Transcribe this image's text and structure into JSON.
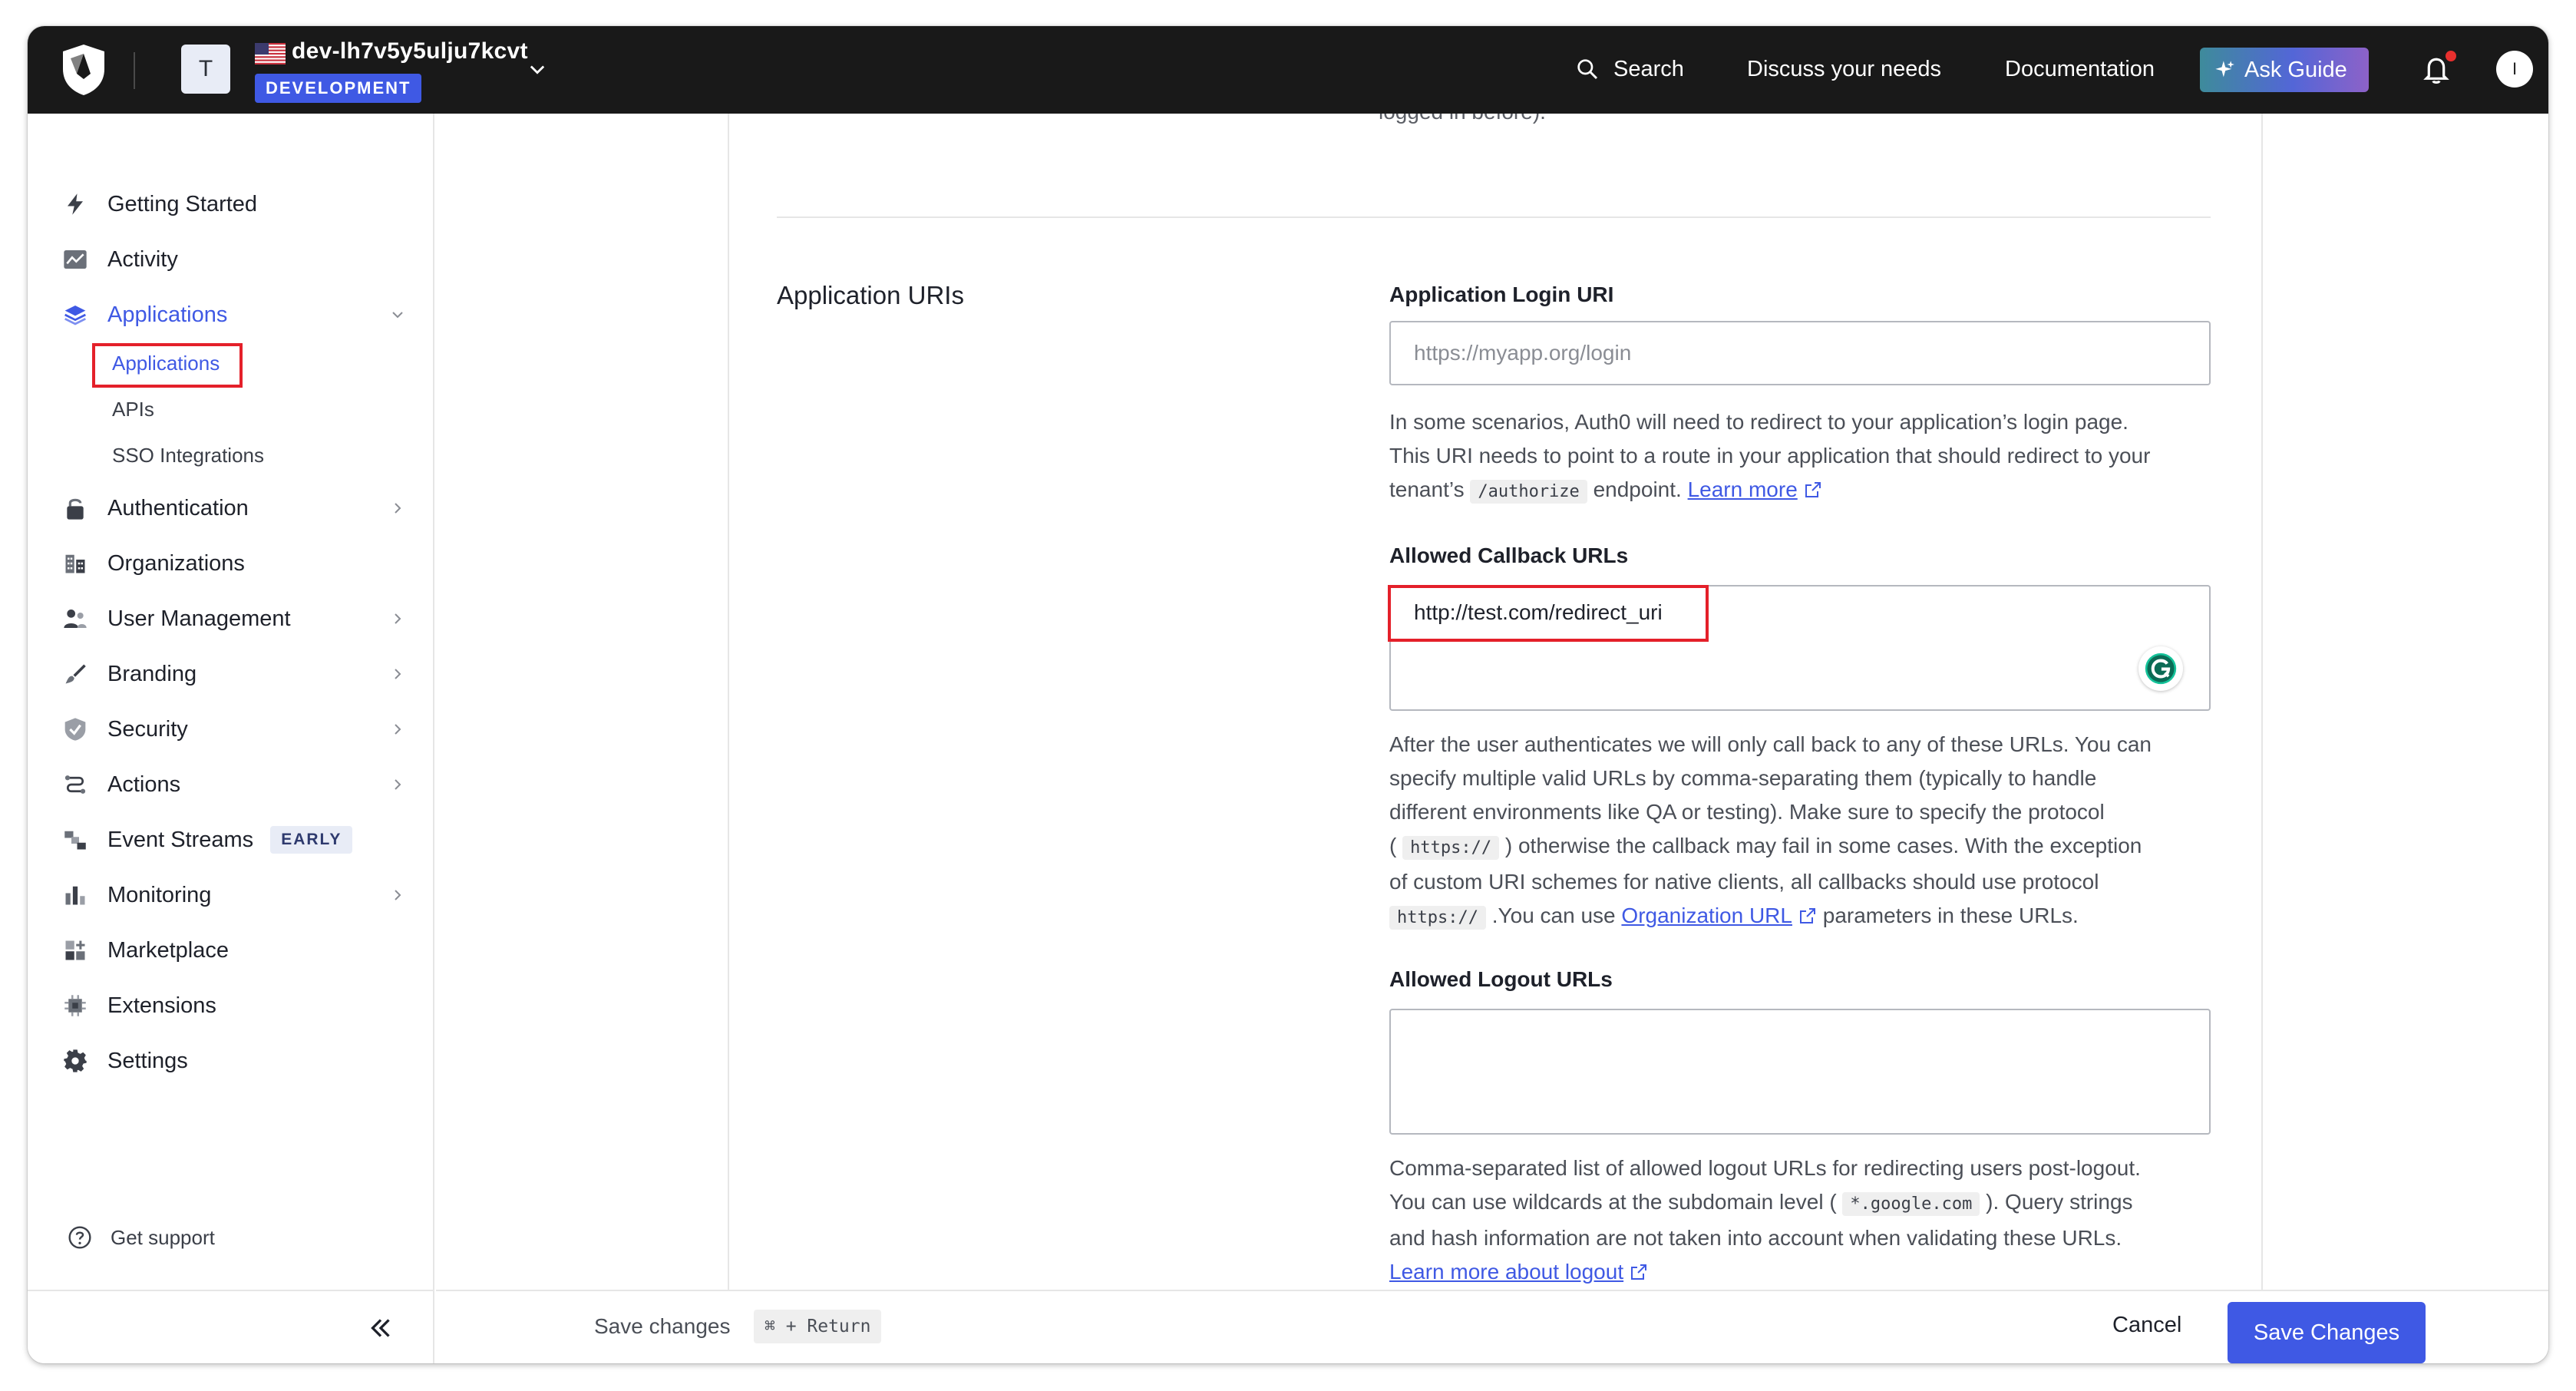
{
  "topbar": {
    "tenant_initial": "T",
    "tenant_name": "dev-lh7v5y5ulju7kcvt",
    "env_badge": "DEVELOPMENT",
    "search_label": "Search",
    "discuss_label": "Discuss your needs",
    "docs_label": "Documentation",
    "ask_guide_label": "Ask Guide",
    "user_initial": "I",
    "notification_dot_color": "#e8302e"
  },
  "sidebar": {
    "items": [
      {
        "label": "Getting Started",
        "icon": "lightning-icon"
      },
      {
        "label": "Activity",
        "icon": "activity-chart-icon"
      },
      {
        "label": "Applications",
        "icon": "layers-icon"
      },
      {
        "label": "Authentication",
        "icon": "lock-icon"
      },
      {
        "label": "Organizations",
        "icon": "building-icon"
      },
      {
        "label": "User Management",
        "icon": "users-icon"
      },
      {
        "label": "Branding",
        "icon": "brush-icon"
      },
      {
        "label": "Security",
        "icon": "shield-check-icon"
      },
      {
        "label": "Actions",
        "icon": "flow-icon"
      },
      {
        "label": "Event Streams",
        "icon": "streams-icon",
        "badge": "EARLY"
      },
      {
        "label": "Monitoring",
        "icon": "bar-chart-icon"
      },
      {
        "label": "Marketplace",
        "icon": "grid-plus-icon"
      },
      {
        "label": "Extensions",
        "icon": "chip-icon"
      },
      {
        "label": "Settings",
        "icon": "gear-icon"
      }
    ],
    "sub_items": [
      "Applications",
      "APIs",
      "SSO Integrations"
    ],
    "get_support": "Get support"
  },
  "main": {
    "cut_text": "logged in before).",
    "section_title": "Application URIs",
    "login_uri": {
      "label": "Application Login URI",
      "value": "",
      "placeholder": "https://myapp.org/login",
      "help_1": "In some scenarios, Auth0 will need to redirect to your application’s login page.",
      "help_2": "This URI needs to point to a route in your application that should redirect to your",
      "help_3a": "tenant’s",
      "help_3code": "/authorize",
      "help_3b": "endpoint.",
      "help_link": "Learn more"
    },
    "callback": {
      "label": "Allowed Callback URLs",
      "value": "http://test.com/redirect_uri",
      "help_1": "After the user authenticates we will only call back to any of these URLs. You can",
      "help_2": "specify multiple valid URLs by comma-separating them (typically to handle",
      "help_3": "different environments like QA or testing). Make sure to specify the protocol",
      "help_4a": "(",
      "help_4code": "https://",
      "help_4b": ") otherwise the callback may fail in some cases. With the exception",
      "help_5": "of custom URI schemes for native clients, all callbacks should use protocol",
      "help_6code": "https://",
      "help_6a": ".You can use",
      "help_6link": "Organization URL",
      "help_6b": "parameters in these URLs."
    },
    "logout": {
      "label": "Allowed Logout URLs",
      "value": "",
      "help_1": "Comma-separated list of allowed logout URLs for redirecting users post-logout.",
      "help_2a": "You can use wildcards at the subdomain level (",
      "help_2code": "*.google.com",
      "help_2b": "). Query strings",
      "help_3": "and hash information are not taken into account when validating these URLs.",
      "help_link": "Learn more about logout"
    }
  },
  "footer": {
    "save_hint": "Save changes",
    "shortcut": "⌘ + Return",
    "cancel_label": "Cancel",
    "save_label": "Save Changes"
  },
  "colors": {
    "accent": "#3f59e4",
    "highlight": "#e4202a",
    "topbar_bg": "#191919"
  }
}
